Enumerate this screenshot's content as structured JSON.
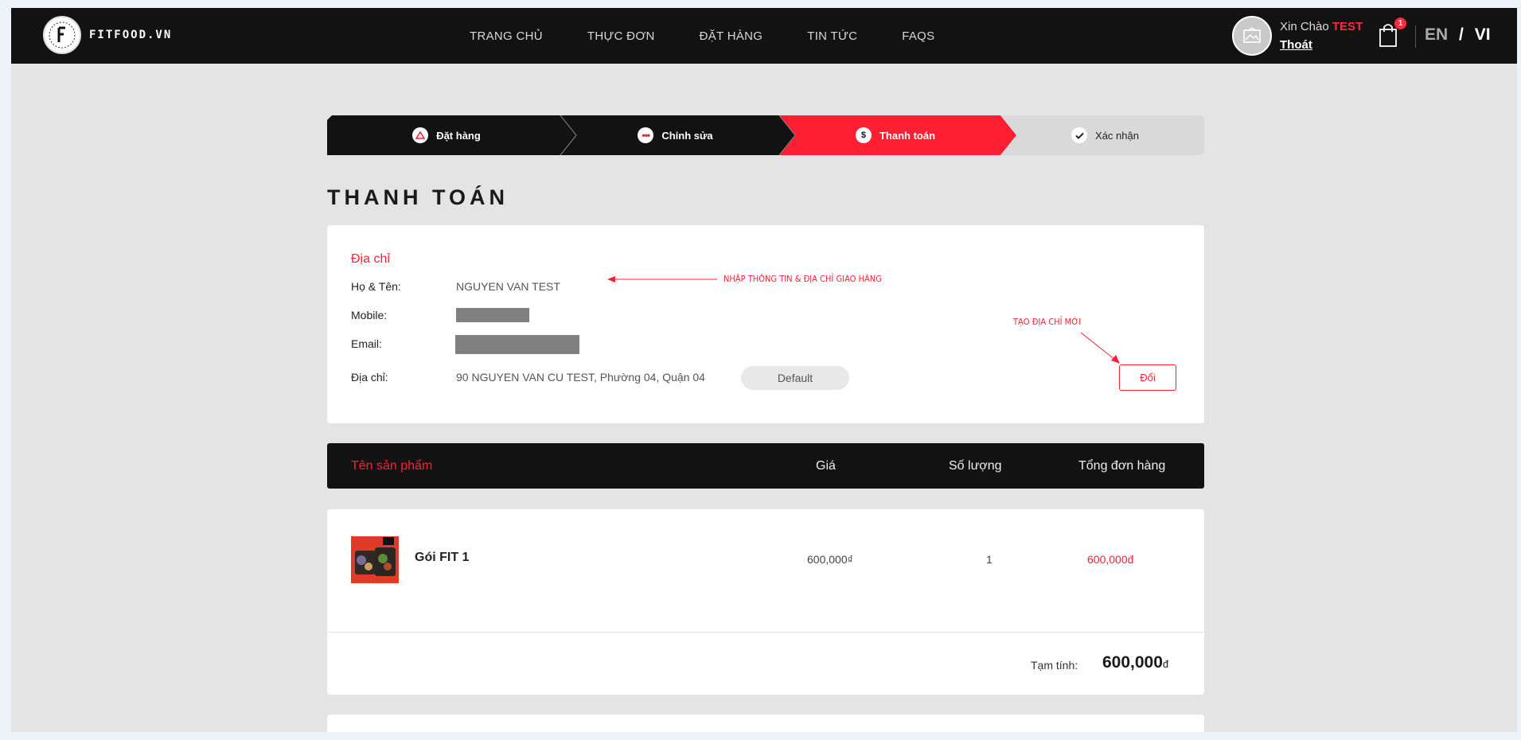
{
  "header": {
    "logo_text": "FITFOOD.VN",
    "nav": [
      "TRANG CHỦ",
      "THỰC ĐƠN",
      "ĐẶT HÀNG",
      "TIN TỨC",
      "FAQS"
    ],
    "greeting": "Xin Chào",
    "user_name": "TEST",
    "logout": "Thoát",
    "cart_count": "1",
    "lang_en": "EN",
    "lang_sep": "/",
    "lang_vi": "VI"
  },
  "steps": [
    {
      "label": "Đặt hàng",
      "state": "done"
    },
    {
      "label": "Chỉnh sửa",
      "state": "done"
    },
    {
      "label": "Thanh toán",
      "state": "active"
    },
    {
      "label": "Xác nhận",
      "state": "pending"
    }
  ],
  "page_title": "THANH TOÁN",
  "address": {
    "title": "Địa chỉ",
    "name_label": "Họ & Tên:",
    "name_value": "NGUYEN VAN TEST",
    "mobile_label": "Mobile:",
    "email_label": "Email:",
    "address_label": "Địa chỉ:",
    "address_value": "90 NGUYEN VAN CU TEST, Phường 04, Quận 04",
    "default_badge": "Default",
    "change_button": "Đổi"
  },
  "annotations": {
    "enter_info": "NHẬP THÔNG TIN & ĐỊA CHỈ GIAO HÀNG",
    "new_address": "TẠO ĐỊA CHỈ MỚI"
  },
  "table": {
    "col_product": "Tên sản phẩm",
    "col_price": "Giá",
    "col_qty": "Số lượng",
    "col_total": "Tổng đơn hàng"
  },
  "items": [
    {
      "name": "Gói FIT 1",
      "price": "600,000₫",
      "qty": "1",
      "total": "600,000đ"
    }
  ],
  "subtotal": {
    "label": "Tạm tính:",
    "value": "600,000",
    "currency": "đ"
  },
  "colors": {
    "accent": "#ff1f33",
    "dark": "#121212",
    "step_pending": "#d9d9d9"
  }
}
